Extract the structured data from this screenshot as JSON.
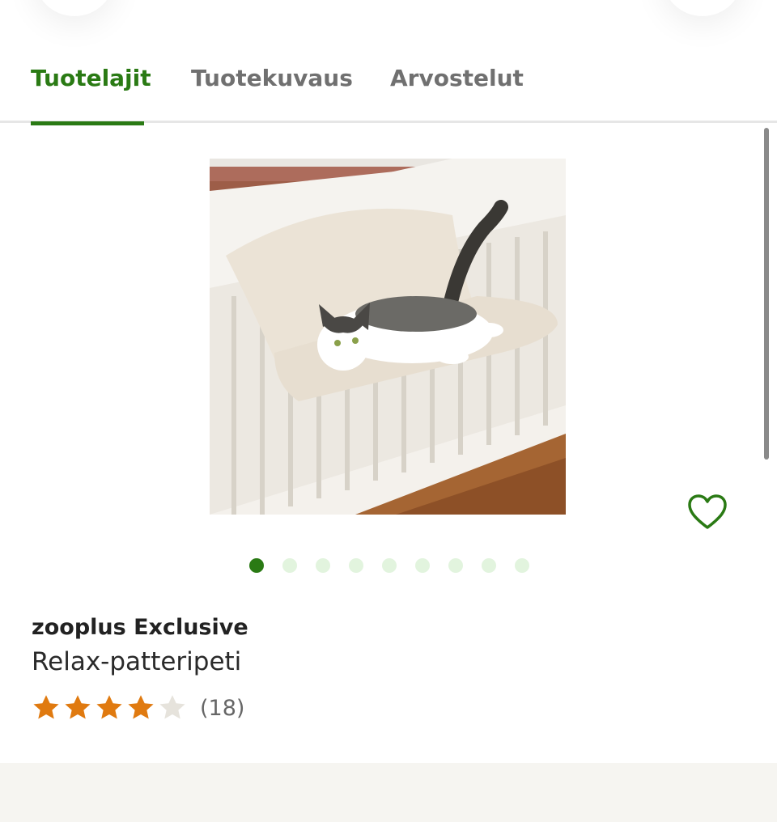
{
  "tabs": [
    {
      "label": "Tuotelajit",
      "active": true
    },
    {
      "label": "Tuotekuvaus",
      "active": false
    },
    {
      "label": "Arvostelut",
      "active": false
    }
  ],
  "product": {
    "brand": "zooplus Exclusive",
    "name": "Relax-patteripeti",
    "rating": 4,
    "rating_max": 5,
    "review_count": "(18)"
  },
  "gallery": {
    "total_images": 9,
    "current_image": 1
  },
  "icons": {
    "favorite": "heart-outline-icon",
    "star": "star-icon"
  },
  "colors": {
    "accent": "#2a7a14",
    "star_filled": "#e07a10",
    "star_empty": "#e6e3dc",
    "dot_inactive": "#e2f4de"
  }
}
